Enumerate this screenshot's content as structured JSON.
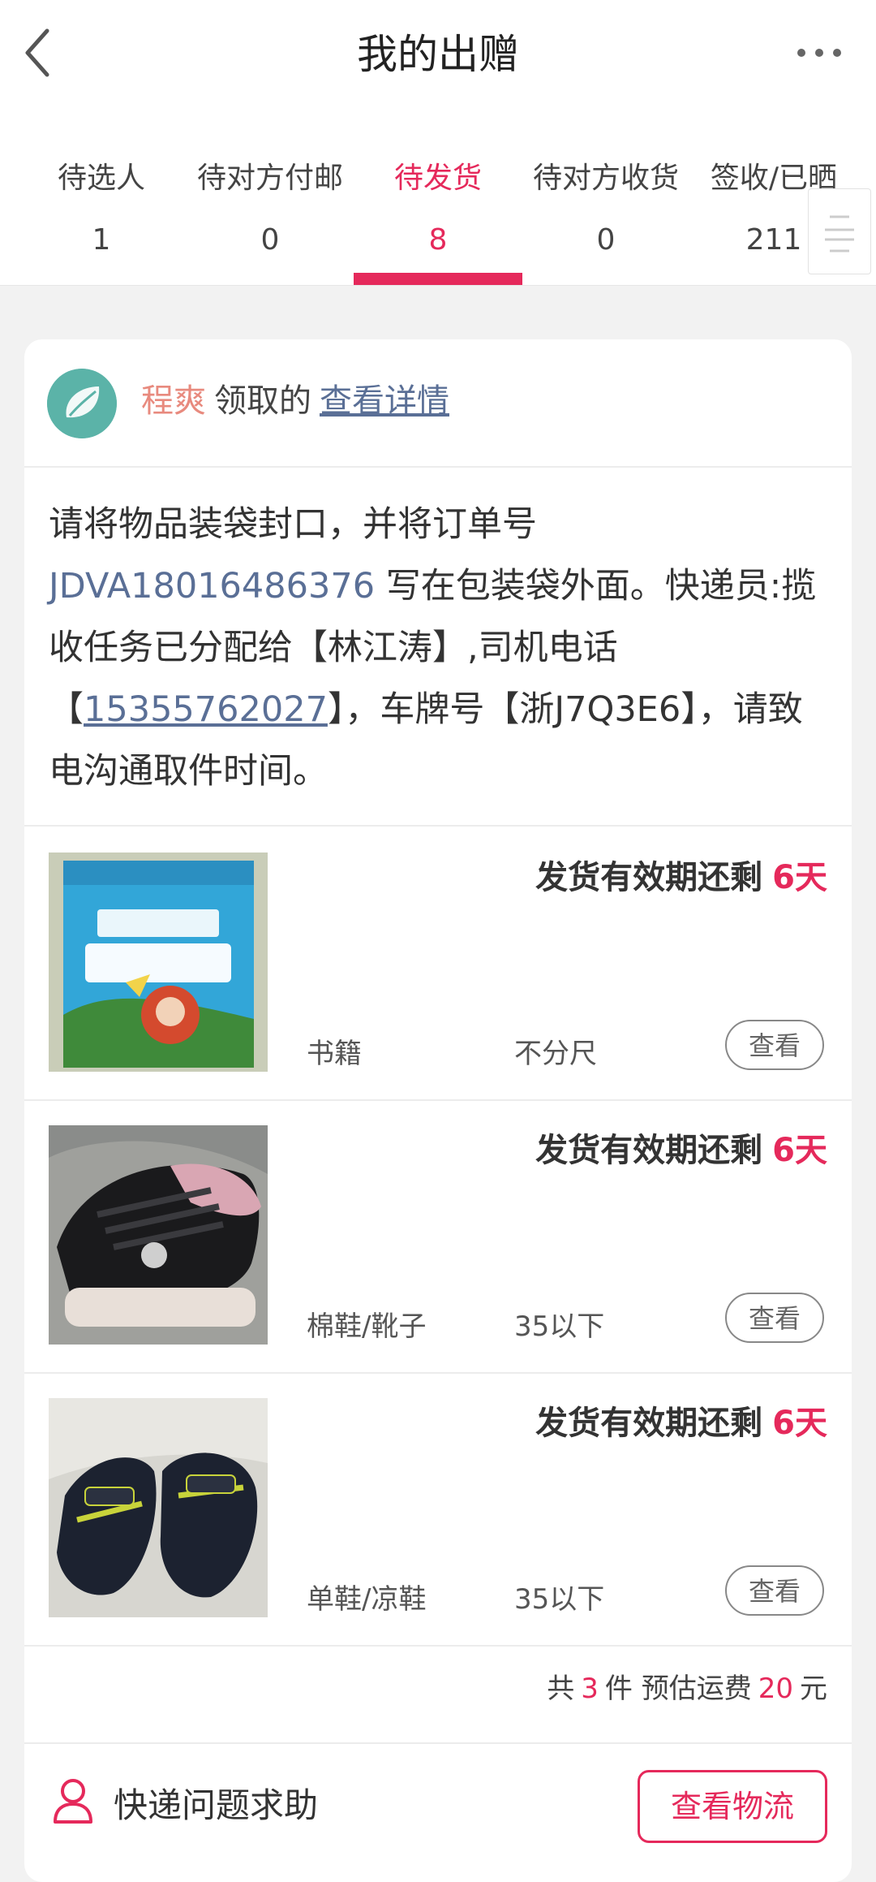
{
  "header": {
    "title": "我的出赠"
  },
  "tabs": [
    {
      "label": "待选人",
      "count": "1"
    },
    {
      "label": "待对方付邮",
      "count": "0"
    },
    {
      "label": "待发货",
      "count": "8",
      "active": true
    },
    {
      "label": "待对方收货",
      "count": "0"
    },
    {
      "label": "签收/已晒",
      "count": "211"
    }
  ],
  "order": {
    "receiver_name": "程爽",
    "receiver_text": "领取的",
    "detail_link": "查看详情",
    "notice_part1": "请将物品装袋封口，并将订单号 ",
    "order_number": "JDVA18016486376",
    "notice_part2": " 写在包装袋外面。快递员:揽收任务已分配给【林江涛】,司机电话【",
    "driver_phone": "15355762027",
    "notice_part3": "】，车牌号【浙J7Q3E6】，请致电沟通取件时间。",
    "items": [
      {
        "deadline_label": "发货有效期还剩",
        "deadline_days": "6天",
        "category": "书籍",
        "size": "不分尺",
        "view_label": "查看",
        "image_icon": "flashcard-pack-photo"
      },
      {
        "deadline_label": "发货有效期还剩",
        "deadline_days": "6天",
        "category": "棉鞋/靴子",
        "size": "35以下",
        "view_label": "查看",
        "image_icon": "black-sneaker-photo"
      },
      {
        "deadline_label": "发货有效期还剩",
        "deadline_days": "6天",
        "category": "单鞋/凉鞋",
        "size": "35以下",
        "view_label": "查看",
        "image_icon": "kids-shoes-photo"
      }
    ],
    "summary": {
      "prefix": "共",
      "count": "3",
      "mid": "件 预估运费",
      "fee": "20",
      "suffix": "元"
    },
    "help_text": "快递问题求助",
    "logistics_button": "查看物流"
  },
  "colors": {
    "accent": "#e5295b",
    "link": "#5a6f96",
    "receiver_name": "#e88a7e"
  }
}
